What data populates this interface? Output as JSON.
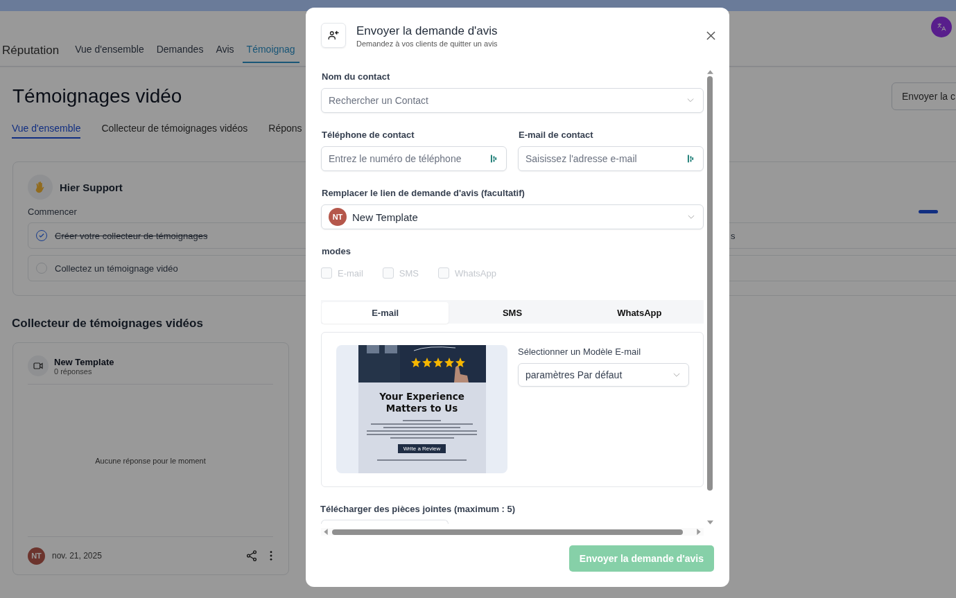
{
  "top_nav": {
    "title": "Réputation",
    "tabs": [
      {
        "label": "Vue d'ensemble",
        "selected": false
      },
      {
        "label": "Demandes",
        "selected": false
      },
      {
        "label": "Avis",
        "selected": false
      },
      {
        "label": "Témoignag",
        "selected": true
      }
    ]
  },
  "page": {
    "title": "Témoignages vidéo",
    "header_button": "Envoyer la c",
    "subtabs": [
      {
        "label": "Vue d'ensemble",
        "selected": true
      },
      {
        "label": "Collecteur de témoignages vidéos",
        "selected": false
      },
      {
        "label": "Répons",
        "selected": false
      }
    ],
    "getting_started": {
      "name": "Hier Support",
      "section": "Commencer",
      "tasks": [
        {
          "label": "Créer votre collecteur de témoignages",
          "done": true,
          "right_text": "s"
        },
        {
          "label": "Collectez un témoignage vidéo",
          "done": false
        }
      ]
    },
    "collector_heading": "Collecteur de témoignages vidéos",
    "collector_card": {
      "name": "New Template",
      "responses": "0 réponses",
      "empty_text": "Aucune réponse pour le moment",
      "avatar": "NT",
      "date": "nov. 21, 2025"
    }
  },
  "modal": {
    "title": "Envoyer la demande d'avis",
    "subtitle": "Demandez à vos clients de quitter un avis",
    "contact_name": {
      "label": "Nom du contact",
      "placeholder": "Rechercher un Contact"
    },
    "phone": {
      "label": "Téléphone de contact",
      "placeholder": "Entrez le numéro de téléphone"
    },
    "email": {
      "label": "E-mail de contact",
      "placeholder": "Saisissez l'adresse e-mail"
    },
    "review_link": {
      "label": "Remplacer le lien de demande d'avis (facultatif)",
      "avatar": "NT",
      "value": "New Template"
    },
    "modes": {
      "label": "modes",
      "disabled": true,
      "options": [
        {
          "label": "E-mail",
          "checked": false
        },
        {
          "label": "SMS",
          "checked": false
        },
        {
          "label": "WhatsApp",
          "checked": false
        }
      ]
    },
    "channel_tabs": [
      {
        "label": "E-mail",
        "selected": true
      },
      {
        "label": "SMS",
        "selected": false
      },
      {
        "label": "WhatsApp",
        "selected": false
      }
    ],
    "email_template": {
      "label": "Sélectionner un Modèle E-mail",
      "value": "paramètres Par défaut",
      "preview": {
        "title": "Your Experience Matters to Us",
        "button": "Write a Review"
      }
    },
    "attachments": {
      "label": "Télécharger des pièces jointes (maximum : 5)"
    },
    "submit": {
      "label": "Envoyer la demande d'avis",
      "disabled": true
    }
  }
}
